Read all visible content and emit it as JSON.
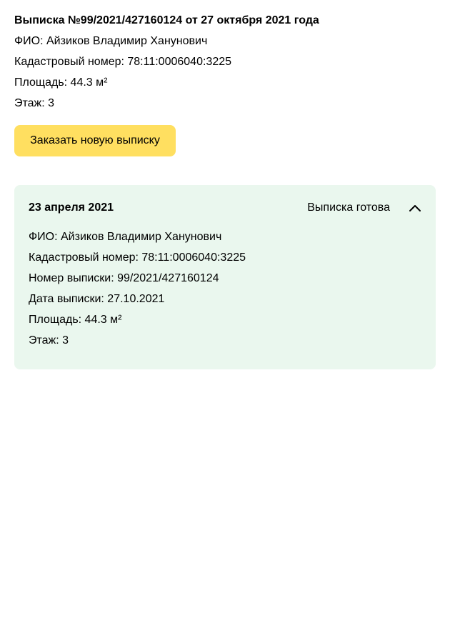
{
  "summary": {
    "title": "Выписка №99/2021/427160124 от 27 октября 2021 года",
    "owner": "ФИО: Айзиков Владимир Ханунович",
    "cadastral": "Кадастровый номер: 78:11:0006040:3225",
    "area": "Площадь: 44.3 м²",
    "floor": "Этаж: 3"
  },
  "order_button": {
    "label": "Заказать новую выписку"
  },
  "record": {
    "date": "23 апреля 2021",
    "status": "Выписка готова",
    "toggle_icon": "chevron-up-icon",
    "details": {
      "owner": "ФИО: Айзиков Владимир Ханунович",
      "cadastral": "Кадастровый номер: 78:11:0006040:3225",
      "statement_number": "Номер выписки: 99/2021/427160124",
      "statement_date": "Дата выписки: 27.10.2021",
      "area": "Площадь: 44.3 м²",
      "floor": "Этаж: 3"
    }
  },
  "colors": {
    "button_background": "#ffdf60",
    "card_background": "#eaf7ee",
    "text": "#000000"
  }
}
